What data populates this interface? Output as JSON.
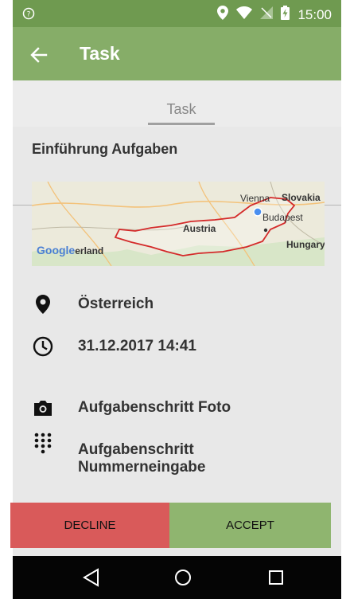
{
  "status_bar": {
    "time": "15:00"
  },
  "app_bar": {
    "title": "Task"
  },
  "tabs": [
    {
      "label": "Task"
    }
  ],
  "task": {
    "title": "Einführung Aufgaben",
    "map_labels": {
      "vienna": "Vienna",
      "slovakia": "Slovakia",
      "budapest": "Budapest",
      "hungary": "Hungary",
      "austria": "Austria",
      "google_logo": "Google",
      "swiss": "erland"
    },
    "location": "Österreich",
    "datetime": "31.12.2017 14:41",
    "steps": [
      {
        "icon": "camera-icon",
        "label": "Aufgabenschritt Foto"
      },
      {
        "icon": "dialpad-icon",
        "label": "Aufgabenschritt\nNummerneingabe"
      }
    ]
  },
  "actions": {
    "decline": "DECLINE",
    "accept": "ACCEPT"
  },
  "colors": {
    "status_bar": "#6f9a50",
    "app_bar": "#86ad68",
    "decline": "#d95a5a",
    "accept": "#8fb56f",
    "background": "#e8e8e8"
  }
}
